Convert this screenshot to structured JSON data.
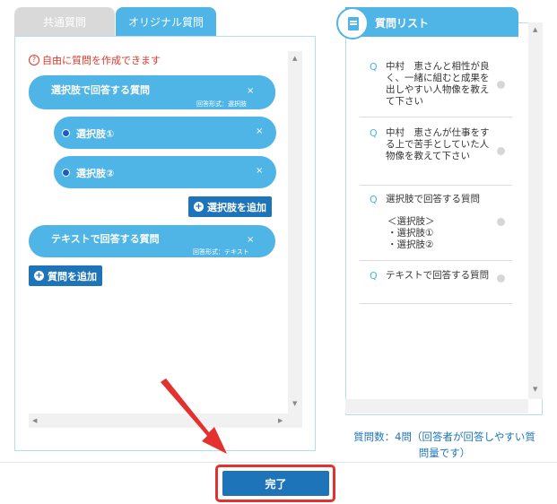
{
  "tabs": [
    {
      "label": "共通質問",
      "active": false
    },
    {
      "label": "オリジナル質問",
      "active": true
    }
  ],
  "left": {
    "notice": "自由に質問を作成できます",
    "questions": [
      {
        "title": "選択肢で回答する質問",
        "answer_format": "回答形式：選択肢",
        "close": "×"
      },
      {
        "title": "テキストで回答する質問",
        "answer_format": "回答形式：テキスト",
        "close": "×"
      }
    ],
    "choices": [
      {
        "label": "選択肢①",
        "close": "×"
      },
      {
        "label": "選択肢②",
        "close": "×"
      }
    ],
    "add_choice_label": "選択肢を追加",
    "add_question_label": "質問を追加"
  },
  "right": {
    "title": "質問リスト",
    "items": [
      {
        "mark": "Q",
        "text": "中村　恵さんと相性が良く、一緒に組むと成果を出しやすい人物像を教えて下さい"
      },
      {
        "mark": "Q",
        "text": "中村　恵さんが仕事をする上で苦手としていた人物像を教えて下さい"
      },
      {
        "mark": "Q",
        "text": "選択肢で回答する質問",
        "sub": [
          "＜選択肢＞",
          "・選択肢①",
          "・選択肢②"
        ]
      },
      {
        "mark": "Q",
        "text": "テキストで回答する質問"
      }
    ],
    "count_line1": "質問数：4問（回答者が回答しやすい質",
    "count_line2": "問量です）"
  },
  "footer": {
    "done_label": "完了"
  },
  "colors": {
    "accent": "#4fb4e6",
    "button": "#1d74b9",
    "highlight": "#e53030",
    "notice": "#e0362a"
  }
}
